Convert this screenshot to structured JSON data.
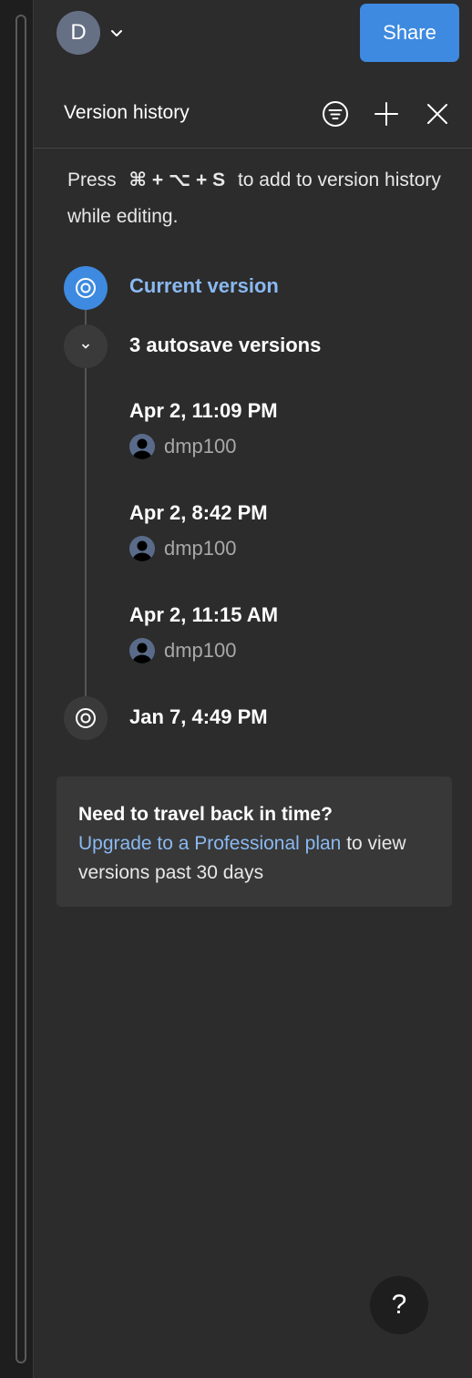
{
  "topbar": {
    "avatar_initial": "D",
    "share_label": "Share"
  },
  "header": {
    "title": "Version history",
    "icons": [
      "filter-icon",
      "plus-icon",
      "close-icon"
    ]
  },
  "hint": {
    "prefix": "Press",
    "shortcut": "⌘ + ⌥ + S",
    "suffix": "to add to version history while editing."
  },
  "timeline": {
    "current_label": "Current version",
    "autosave_label": "3 autosave versions",
    "versions": [
      {
        "date": "Apr 2, 11:09 PM",
        "user": "dmp100"
      },
      {
        "date": "Apr 2, 8:42 PM",
        "user": "dmp100"
      },
      {
        "date": "Apr 2, 11:15 AM",
        "user": "dmp100"
      }
    ],
    "oldest_label": "Jan 7, 4:49 PM"
  },
  "upsell": {
    "title": "Need to travel back in time?",
    "link": "Upgrade to a Professional plan",
    "text_after": "to view versions past 30 days"
  },
  "help": {
    "label": "?"
  },
  "colors": {
    "accent": "#3d8ae0",
    "link": "#8ab9f0",
    "panel_bg": "#2c2c2c"
  }
}
